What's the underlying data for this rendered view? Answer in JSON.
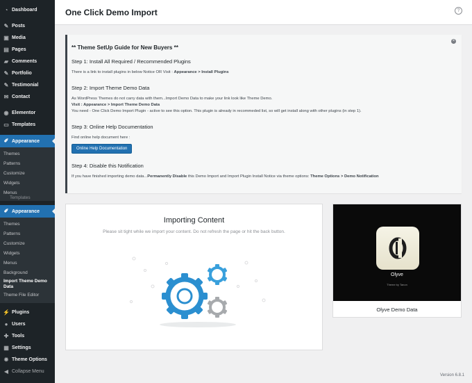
{
  "sidebar": {
    "top_items": [
      {
        "label": "Dashboard",
        "icon": "dashboard-icon"
      },
      {
        "label": "Posts",
        "icon": "pin-icon"
      },
      {
        "label": "Media",
        "icon": "media-icon"
      },
      {
        "label": "Pages",
        "icon": "page-icon"
      },
      {
        "label": "Comments",
        "icon": "comment-icon"
      },
      {
        "label": "Portfolio",
        "icon": "portfolio-icon"
      },
      {
        "label": "Testimonial",
        "icon": "testimonial-icon"
      },
      {
        "label": "Contact",
        "icon": "mail-icon"
      },
      {
        "label": "Elementor",
        "icon": "elementor-icon"
      },
      {
        "label": "Templates",
        "icon": "folder-icon"
      }
    ],
    "appearance_1": {
      "label": "Appearance",
      "subitems": [
        "Themes",
        "Patterns",
        "Customize",
        "Widgets",
        "Menus"
      ],
      "ghost_label": "Templates"
    },
    "appearance_2": {
      "label": "Appearance",
      "subitems": [
        "Themes",
        "Patterns",
        "Customize",
        "Widgets",
        "Menus",
        "Background"
      ],
      "current_line1": "Import Theme Demo",
      "current_line2": "Data",
      "last_sub": "Theme File Editor"
    },
    "bottom_items": [
      {
        "label": "Plugins",
        "icon": "plugin-icon"
      },
      {
        "label": "Users",
        "icon": "users-icon"
      },
      {
        "label": "Tools",
        "icon": "tools-icon"
      },
      {
        "label": "Settings",
        "icon": "settings-icon"
      },
      {
        "label": "Theme Options",
        "icon": "gear-icon"
      }
    ],
    "collapse_label": "Collapse Menu"
  },
  "header": {
    "title": "One Click Demo Import",
    "help_symbol": "?"
  },
  "notice": {
    "close_symbol": "×",
    "title": "** Theme SetUp Guide for New Buyers **",
    "step1_title": "Step 1: Install All Required / Recommended Plugins",
    "step1_text": "There is a link to install plugins in below Notice OR Visit : ",
    "step1_bold": "Appearance > Install Plugins",
    "step2_title": "Step 2: Import Theme Demo Data",
    "step2_line1": "As WordPress Themes do not carry data with them...Import Demo Data to make your link look like Theme Demo.",
    "step2_visit": "Visit : Appearance > Import Theme Demo Data",
    "step2_line3": "You need - One Click Demo Import Plugin - active to see this option. This plugin is already in recommeded list, so will get install along with other plugins (in step 1).",
    "step3_title": "Step 3: Online Help Documentation",
    "step3_text": "Find online help document here :",
    "step3_button": "Online Help Documentation",
    "step4_title": "Step 4: Disable this Notification",
    "step4_text1": "If you have finished importing demo data...",
    "step4_bold1": "Permanently Disable",
    "step4_text2": " this Demo Import and Import Plugin Install Notice via theme options: ",
    "step4_bold2": "Theme Options > Demo Notification"
  },
  "import": {
    "title": "Importing Content",
    "description": "Please sit tight while we import your content. Do not refresh the page or hit the back button."
  },
  "demo": {
    "logo_name": "Olyve",
    "credit": "Theme by Tanon",
    "name": "Olyve Demo Data"
  },
  "footer": {
    "version": "Version 6.8.1"
  },
  "colors": {
    "accent": "#2271b1",
    "sidebar": "#1d2327",
    "gear_blue": "#2b8fd0",
    "gear_grey": "#a7aaad"
  }
}
